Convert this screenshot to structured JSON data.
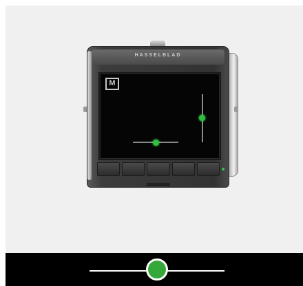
{
  "viewer": {
    "background": "#f0f0f0",
    "brand_text": "HASSELBLAD",
    "screen_icon": "manual-mode-icon",
    "screen_icon_glyph": "M",
    "indicator_color": "#30c040"
  },
  "slider": {
    "value": 0.5,
    "track_color": "#ffffff",
    "thumb_color": "#36a83a",
    "bar_color": "#000000"
  }
}
